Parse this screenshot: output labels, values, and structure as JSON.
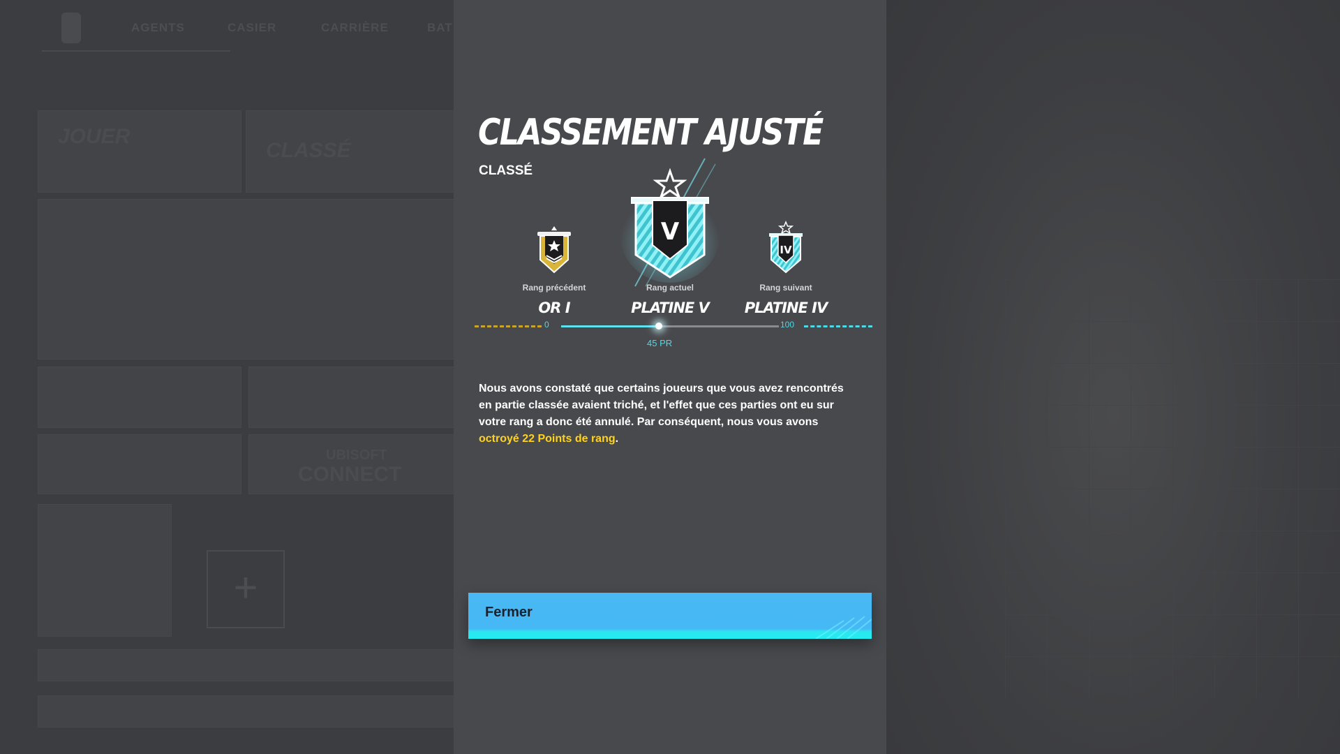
{
  "background": {
    "nav_tabs": [
      "AGENTS",
      "CASIER",
      "CARRIÈRE",
      "BAT"
    ],
    "card_texts": [
      "JOUER",
      "CLASSÉ",
      "UBISOFT",
      "CONNECT"
    ]
  },
  "modal": {
    "title": "CLASSEMENT AJUSTÉ",
    "subtitle": "CLASSÉ",
    "ranks": {
      "previous": {
        "caption": "Rang précédent",
        "name": "OR I",
        "emblem": "gold-rank-icon"
      },
      "current": {
        "caption": "Rang actuel",
        "name": "PLATINE V",
        "emblem": "platinum-rank-icon",
        "numeral": "V"
      },
      "next": {
        "caption": "Rang suivant",
        "name": "PLATINE IV",
        "emblem": "platinum-rank-icon",
        "numeral": "IV"
      }
    },
    "progress": {
      "min_label": "0",
      "max_label": "100",
      "value": 45,
      "max": 100,
      "value_label": "45 PR"
    },
    "message": {
      "text": "Nous avons constaté que certains joueurs que vous avez rencontrés en partie classée avaient triché, et l'effet que ces parties ont eu sur votre rang a donc été annulé. Par conséquent, nous vous avons ",
      "highlight": "octroyé 22 Points de rang",
      "end": "."
    },
    "close_button": "Fermer"
  },
  "colors": {
    "accent_cyan": "#4fd8e6",
    "highlight_yellow": "#ffd21e",
    "button_blue": "#45b8f5",
    "gold": "#c9a52e"
  }
}
